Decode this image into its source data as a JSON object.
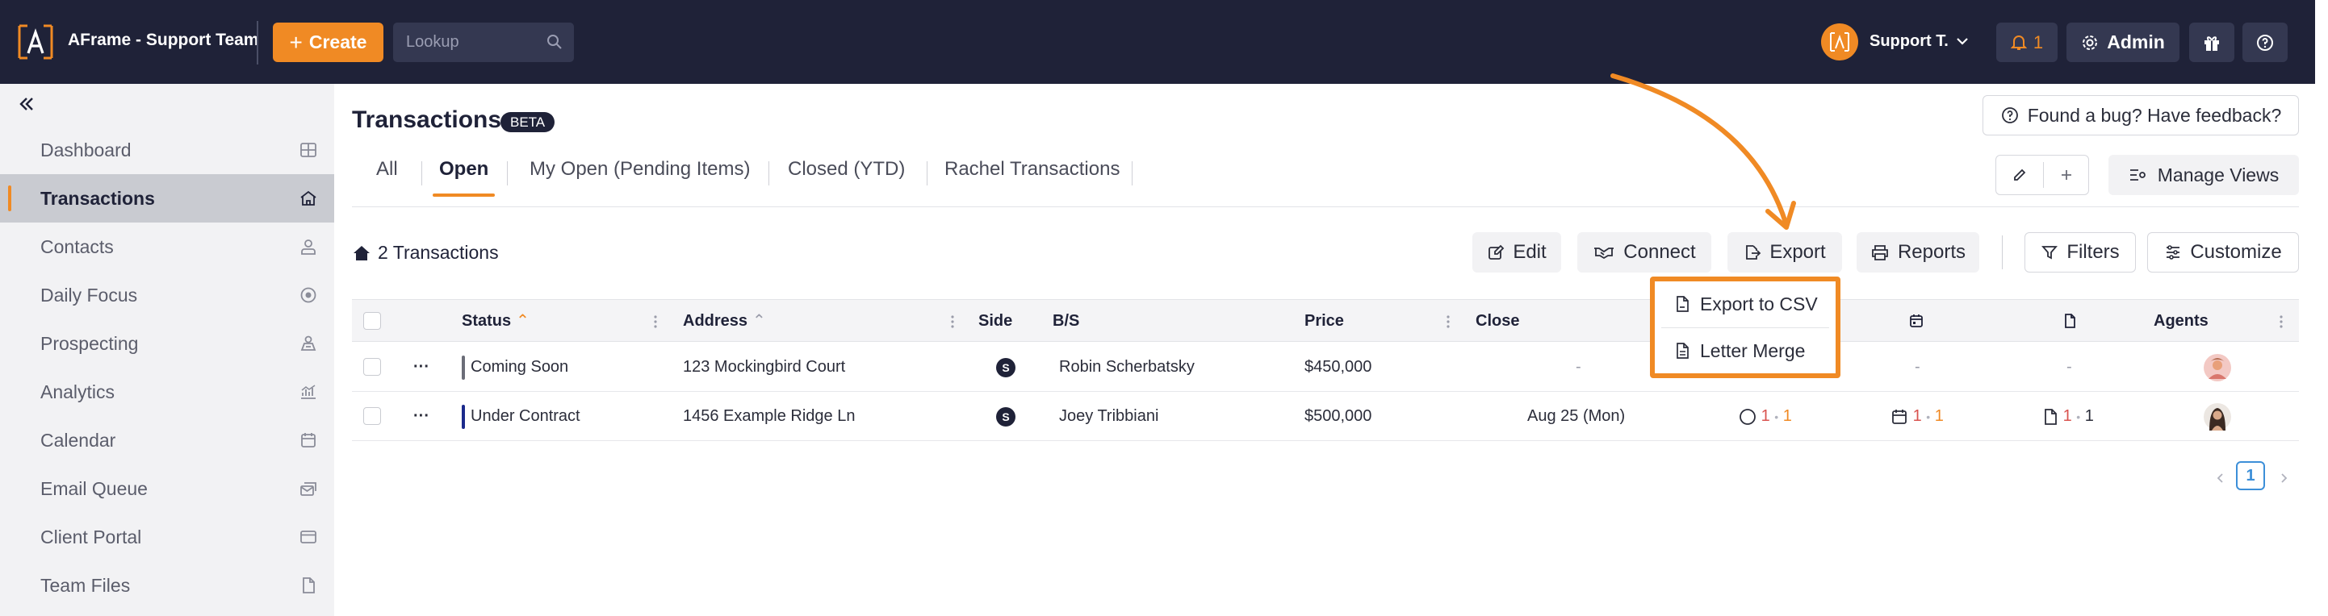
{
  "header": {
    "app_title": "AFrame - Support Team",
    "create_label": "Create",
    "lookup_placeholder": "Lookup",
    "user_name": "Support T.",
    "notif_count": "1",
    "admin_label": "Admin"
  },
  "sidebar": {
    "items": [
      {
        "label": "Dashboard",
        "icon": "grid-icon"
      },
      {
        "label": "Transactions",
        "icon": "home-icon",
        "active": true
      },
      {
        "label": "Contacts",
        "icon": "user-icon"
      },
      {
        "label": "Daily Focus",
        "icon": "target-icon"
      },
      {
        "label": "Prospecting",
        "icon": "prospecting-icon"
      },
      {
        "label": "Analytics",
        "icon": "chart-icon"
      },
      {
        "label": "Calendar",
        "icon": "calendar-icon"
      },
      {
        "label": "Email Queue",
        "icon": "email-queue-icon"
      },
      {
        "label": "Client Portal",
        "icon": "browser-icon"
      },
      {
        "label": "Team Files",
        "icon": "file-icon"
      }
    ]
  },
  "main": {
    "title": "Transactions",
    "beta_badge": "BETA",
    "feedback_label": "Found a bug? Have feedback?",
    "tabs": [
      {
        "label": "All"
      },
      {
        "label": "Open",
        "active": true
      },
      {
        "label": "My Open (Pending Items)"
      },
      {
        "label": "Closed (YTD)"
      },
      {
        "label": "Rachel Transactions"
      }
    ],
    "manage_views_label": "Manage Views",
    "count_label": "2 Transactions",
    "toolbar": {
      "edit": "Edit",
      "connect": "Connect",
      "export": "Export",
      "reports": "Reports",
      "filters": "Filters",
      "customize": "Customize"
    }
  },
  "table": {
    "columns": {
      "status": "Status",
      "address": "Address",
      "side": "Side",
      "bs": "B/S",
      "price": "Price",
      "close": "Close",
      "agents": "Agents"
    },
    "rows": [
      {
        "status": "Coming Soon",
        "status_color": "#6b6d78",
        "address": "123 Mockingbird Court",
        "side": "S",
        "bs": "Robin Scherbatsky",
        "price": "$450,000",
        "close": "-",
        "tasks": "-",
        "dates": "-",
        "docs": "-"
      },
      {
        "status": "Under Contract",
        "status_color": "#1c2a8c",
        "address": "1456 Example Ridge Ln",
        "side": "S",
        "bs": "Joey Tribbiani",
        "price": "$500,000",
        "close": "Aug 25 (Mon)",
        "tasks_a": "1",
        "tasks_b": "1",
        "dates_a": "1",
        "dates_b": "1",
        "docs_a": "1",
        "docs_b": "1"
      }
    ]
  },
  "pagination": {
    "current": "1"
  },
  "export_menu": {
    "items": [
      {
        "label": "Export to CSV"
      },
      {
        "label": "Letter Merge"
      }
    ]
  },
  "colors": {
    "accent": "#f08a24",
    "topbar": "#1f2238",
    "sidebar_bg": "#f2f2f4"
  }
}
